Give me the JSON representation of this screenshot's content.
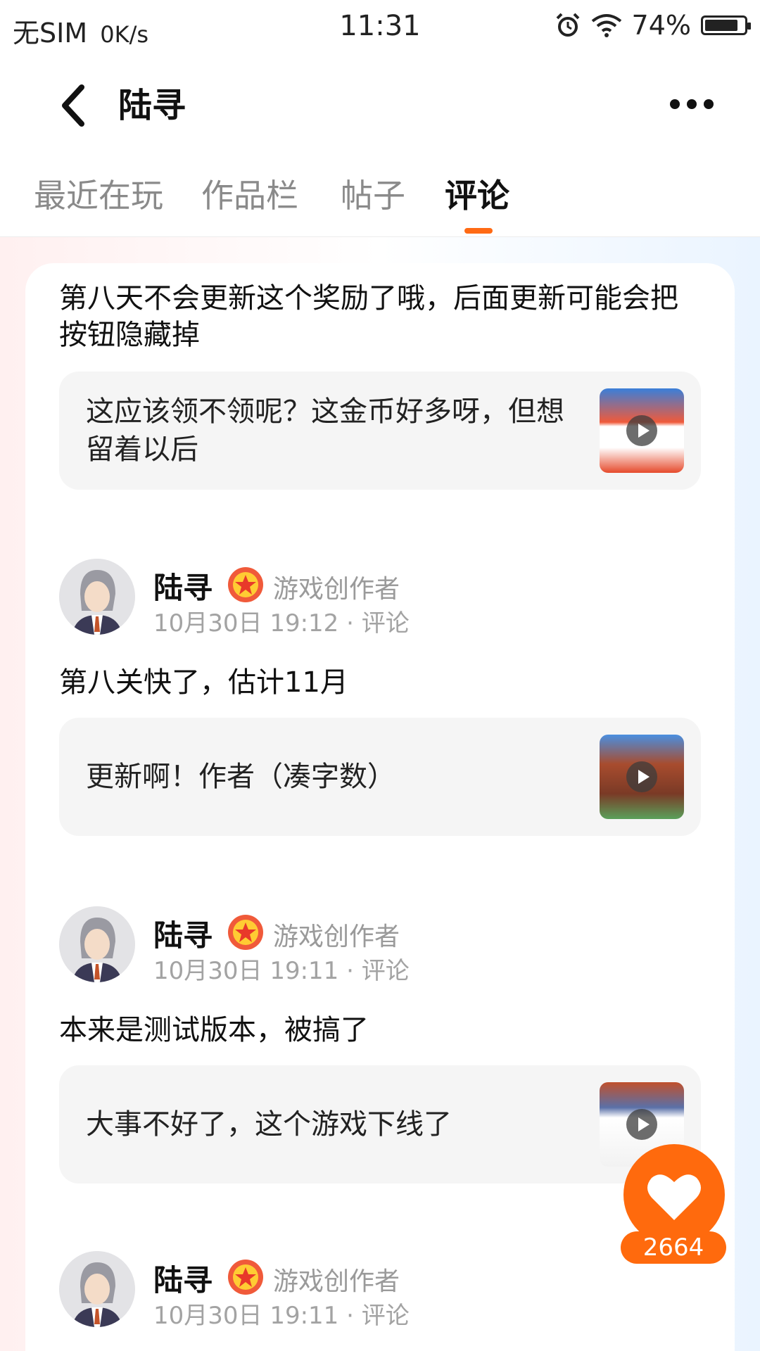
{
  "status_bar": {
    "carrier": "无SIM",
    "speed": "0K/s",
    "time": "11:31",
    "battery": "74%",
    "battery_level": 0.74
  },
  "header": {
    "title": "陆寻",
    "back_icon": "chevron-left-icon",
    "more_icon": "more-horizontal-icon"
  },
  "tabs": [
    {
      "label": "最近在玩"
    },
    {
      "label": "作品栏"
    },
    {
      "label": "帖子"
    },
    {
      "label": "评论",
      "active": true
    }
  ],
  "comments": [
    {
      "text": "第八天不会更新这个奖励了哦，后面更新可能会把按钮隐藏掉",
      "quote": "这应该领不领呢？这金币好多呀，但想留着以后"
    },
    {
      "author": "陆寻",
      "role": "游戏创作者",
      "meta": "10月30日 19:12 · 评论",
      "text": "第八关快了，估计11月",
      "quote": "更新啊！作者（凑字数）"
    },
    {
      "author": "陆寻",
      "role": "游戏创作者",
      "meta": "10月30日 19:11 · 评论",
      "text": "本来是测试版本，被搞了",
      "quote": "大事不好了，这个游戏下线了"
    },
    {
      "author": "陆寻",
      "role": "游戏创作者",
      "meta": "10月30日 19:11 · 评论"
    }
  ],
  "fab": {
    "icon": "heart-icon",
    "count": "2664"
  },
  "colors": {
    "accent": "#ff6a0d",
    "quote_bg": "#f5f5f5"
  }
}
